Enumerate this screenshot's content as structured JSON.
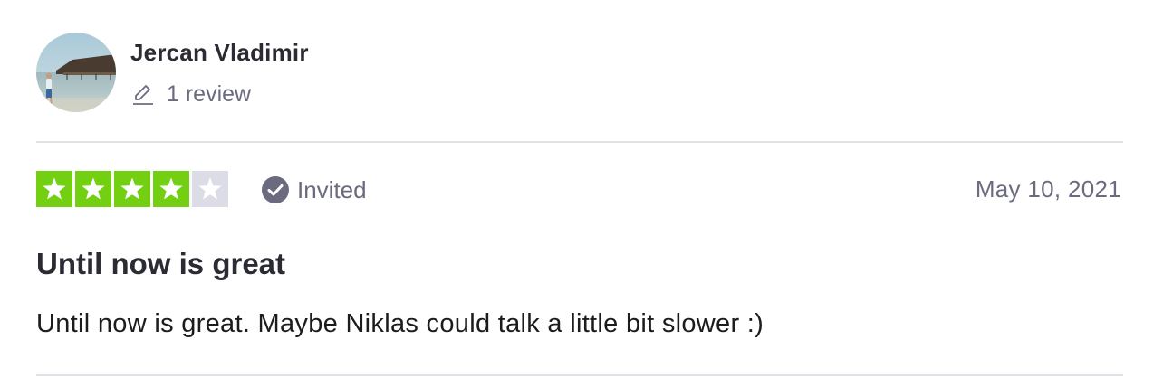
{
  "reviewer": {
    "name": "Jercan Vladimir",
    "review_count": "1 review",
    "avatar_icon": "avatar-photo"
  },
  "rating": {
    "stars": 4,
    "max_stars": 5,
    "filled_color": "#73cf11",
    "empty_color": "#dcdce6"
  },
  "status": {
    "label": "Invited",
    "icon": "check-circle-icon",
    "icon_color": "#6b6b80"
  },
  "review": {
    "date": "May 10, 2021",
    "title": "Until now is great",
    "body": "Until now is great. Maybe Niklas could talk a little bit slower :)"
  },
  "colors": {
    "name_text": "#2b2b33",
    "muted_text": "#6b6b80",
    "divider": "#e0e0e6"
  }
}
